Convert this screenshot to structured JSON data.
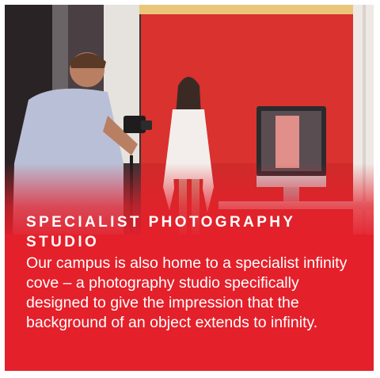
{
  "heading": "SPECIALIST PHOTOGRAPHY STUDIO",
  "body": "Our campus is also home to a specialist infinity cove – a photography studio specifically designed to give the impression that the background of an object extends to infinity.",
  "colors": {
    "brand_red": "#e4202b",
    "text": "#ffffff",
    "backdrop_red": "#d9322f"
  }
}
